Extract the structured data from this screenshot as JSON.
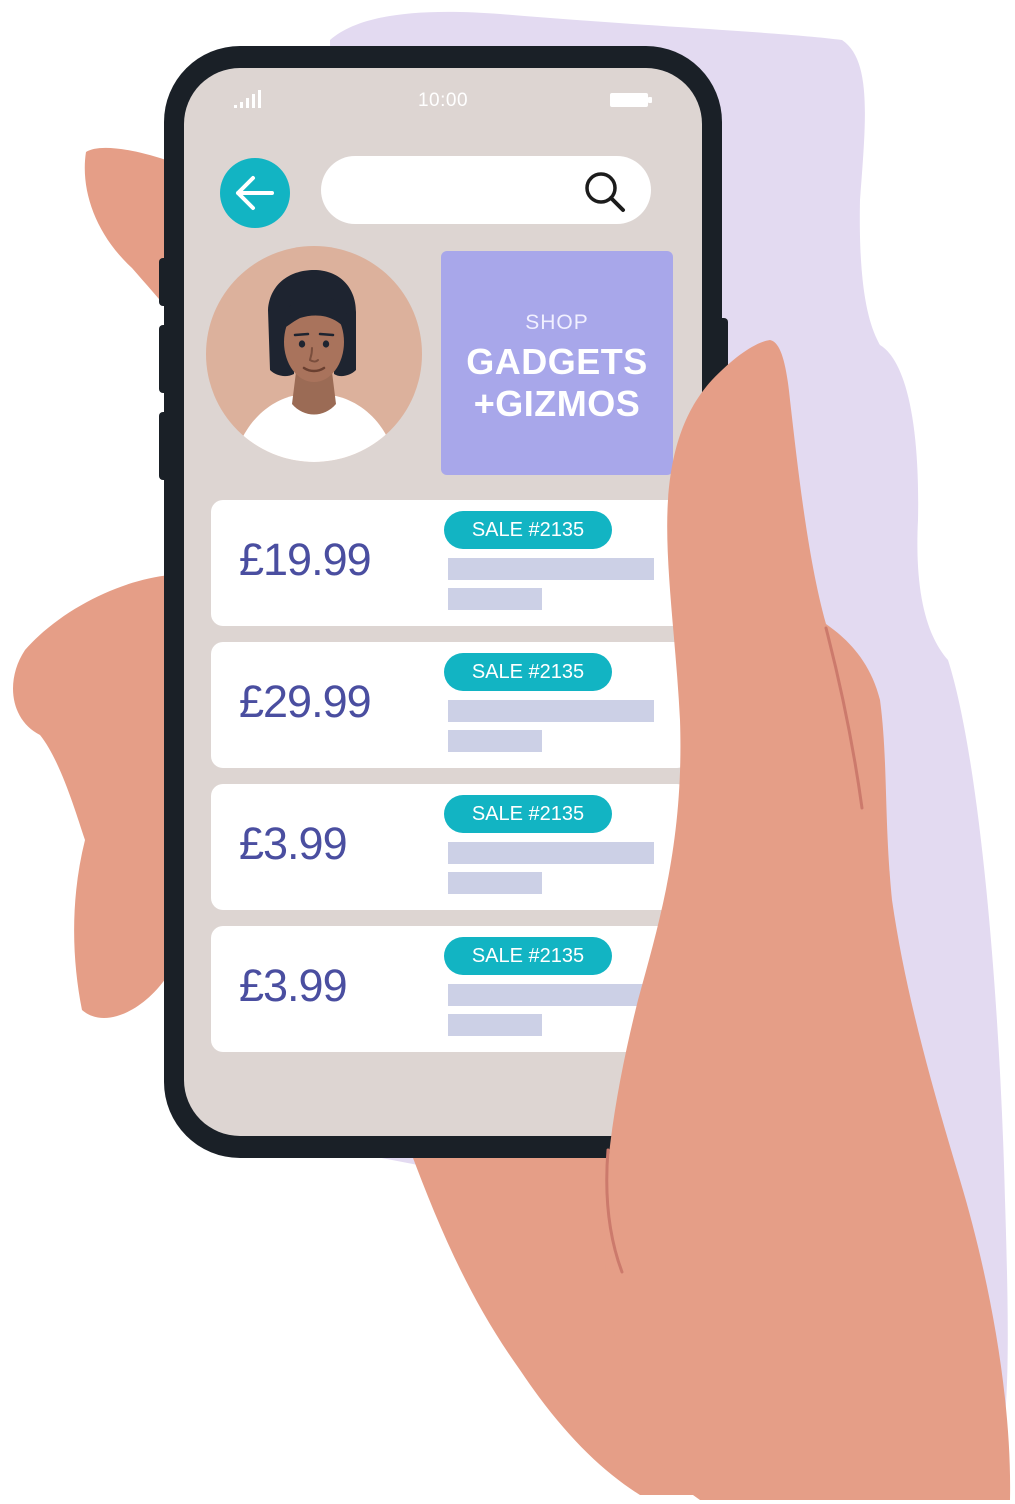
{
  "status_bar": {
    "time": "10:00",
    "signal_icon": "signal-bars-icon",
    "battery_icon": "battery-icon"
  },
  "header": {
    "back_icon": "arrow-left-icon",
    "search": {
      "value": "",
      "placeholder": "",
      "icon": "search-icon"
    }
  },
  "promo": {
    "kicker": "SHOP",
    "line1": "GADGETS",
    "line2": "+GIZMOS"
  },
  "products": [
    {
      "price": "£19.99",
      "badge": "SALE #2135"
    },
    {
      "price": "£29.99",
      "badge": "SALE #2135"
    },
    {
      "price": "£3.99",
      "badge": "SALE #2135"
    },
    {
      "price": "£3.99",
      "badge": "SALE #2135"
    }
  ],
  "colors": {
    "accent": "#12b4c3",
    "price_text": "#4a4ea0",
    "promo_bg": "#a8a7ea",
    "screen_bg": "#ddd5d2",
    "phone_frame": "#1a2027",
    "skin": "#e59e87",
    "backdrop": "#e3daf1"
  }
}
